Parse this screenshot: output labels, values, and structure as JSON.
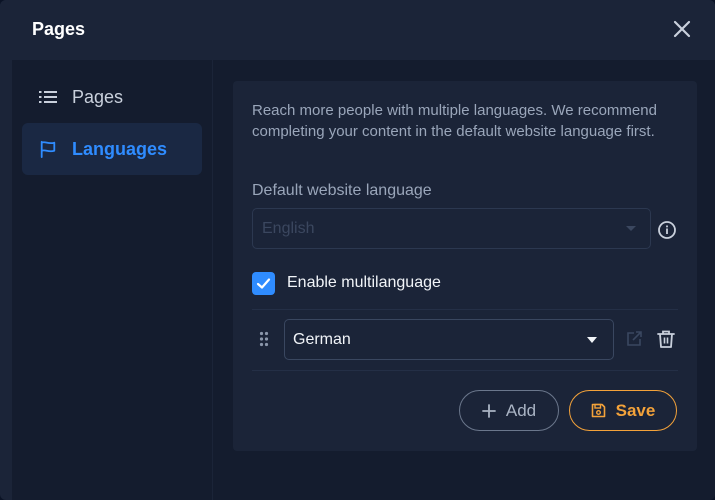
{
  "dialog": {
    "title": "Pages"
  },
  "sidebar": {
    "items": [
      {
        "label": "Pages",
        "icon": "list-icon",
        "active": false
      },
      {
        "label": "Languages",
        "icon": "flag-icon",
        "active": true
      }
    ]
  },
  "languages": {
    "description": "Reach more people with multiple languages. We recommend completing your content in the default website language first.",
    "default_label": "Default website language",
    "default_value": "English",
    "multilang_label": "Enable multilanguage",
    "multilang_checked": true,
    "entries": [
      {
        "value": "German"
      }
    ],
    "add_label": "Add",
    "save_label": "Save"
  },
  "colors": {
    "accent": "#2f8cff",
    "save": "#f3a23a",
    "background": "#1b2438"
  }
}
